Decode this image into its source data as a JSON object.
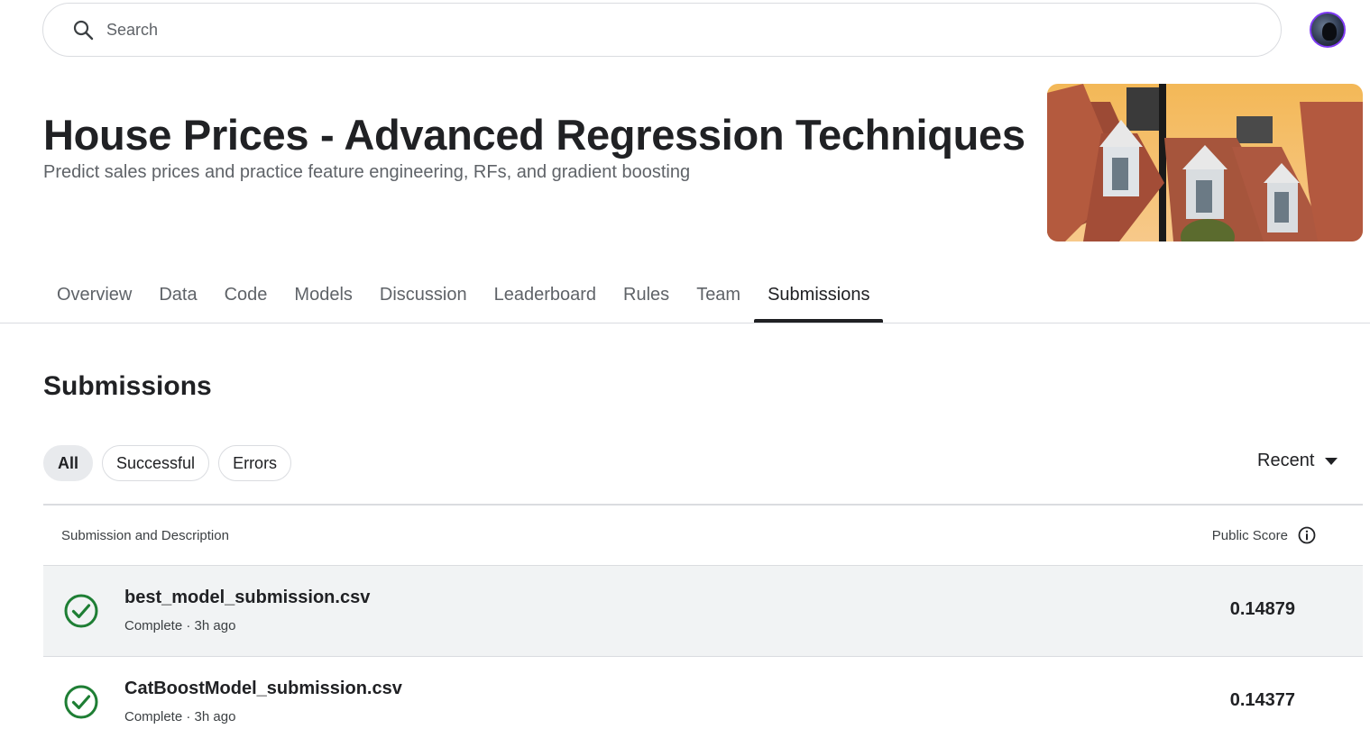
{
  "search": {
    "placeholder": "Search"
  },
  "header": {
    "title": "House Prices - Advanced Regression Techniques",
    "subtitle": "Predict sales prices and practice feature engineering, RFs, and gradient boosting"
  },
  "tabs": [
    {
      "label": "Overview"
    },
    {
      "label": "Data"
    },
    {
      "label": "Code"
    },
    {
      "label": "Models"
    },
    {
      "label": "Discussion"
    },
    {
      "label": "Leaderboard"
    },
    {
      "label": "Rules"
    },
    {
      "label": "Team"
    },
    {
      "label": "Submissions",
      "active": true
    }
  ],
  "section": {
    "title": "Submissions"
  },
  "filters": [
    {
      "label": "All",
      "active": true
    },
    {
      "label": "Successful"
    },
    {
      "label": "Errors"
    }
  ],
  "sort": {
    "label": "Recent"
  },
  "table": {
    "col_submission": "Submission and Description",
    "col_score": "Public Score",
    "rows": [
      {
        "name": "best_model_submission.csv",
        "status": "Complete · 3h ago",
        "score": "0.14879"
      },
      {
        "name": "CatBoostModel_submission.csv",
        "status": "Complete · 3h ago",
        "score": "0.14377"
      }
    ]
  },
  "colors": {
    "success": "#1e7e34",
    "avatar_ring": "#7e3bf2",
    "text_primary": "#202124",
    "text_secondary": "#5f6368"
  },
  "icons": {
    "search": "search-icon",
    "sort": "caret-down-icon",
    "info": "info-icon",
    "status": "check-circle-icon"
  }
}
